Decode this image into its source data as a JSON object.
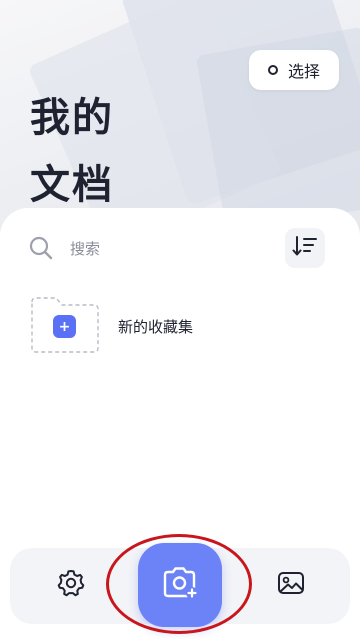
{
  "header": {
    "select_label": "选择",
    "title_line1": "我的",
    "title_line2": "文档"
  },
  "search": {
    "label": "搜索"
  },
  "collections": {
    "new_label": "新的收藏集",
    "new_icon_glyph": "+"
  },
  "bottom_nav": {
    "settings_icon": "gear-icon",
    "camera_icon": "camera-plus-icon",
    "gallery_icon": "image-icon"
  },
  "colors": {
    "accent": "#6b83f7",
    "accent_dark": "#5b71f5",
    "annotation": "#c8161d"
  }
}
